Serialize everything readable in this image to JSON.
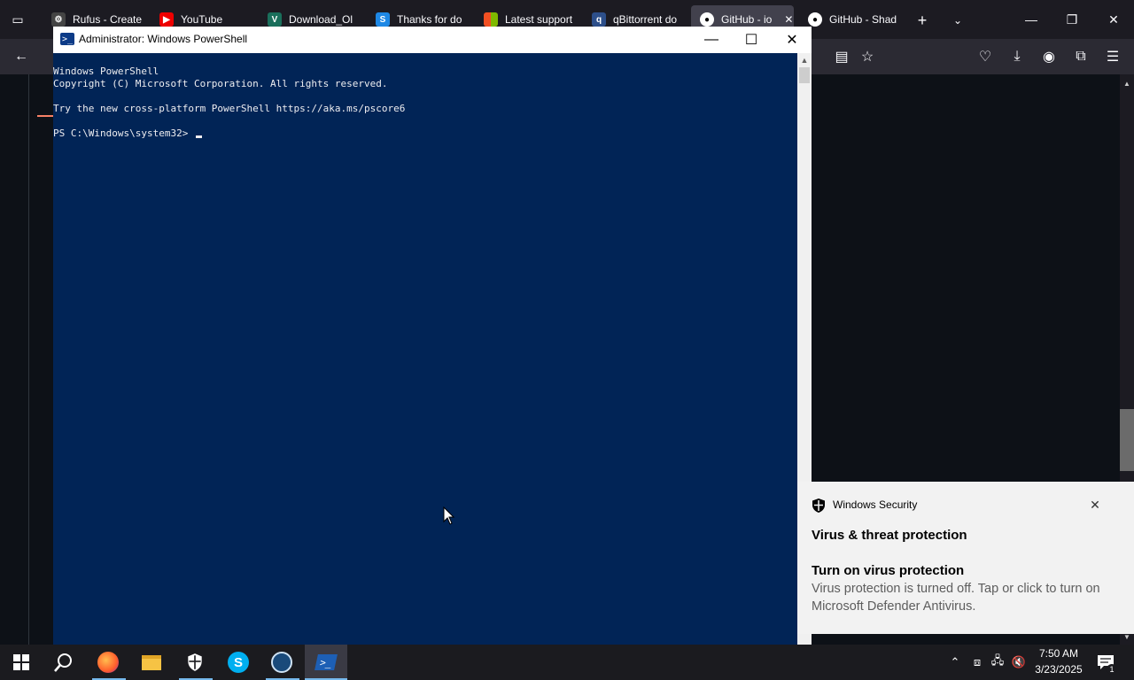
{
  "browser": {
    "tabs": [
      {
        "label": "Rufus - Create",
        "icon": "rufus-icon"
      },
      {
        "label": "YouTube",
        "icon": "youtube-icon"
      },
      {
        "label": "Download_Ol",
        "icon": "download-icon"
      },
      {
        "label": "Thanks for do",
        "icon": "skype-icon"
      },
      {
        "label": "Latest support",
        "icon": "microsoft-icon"
      },
      {
        "label": "qBittorrent do",
        "icon": "qbittorrent-icon"
      },
      {
        "label": "GitHub - io",
        "icon": "github-icon"
      },
      {
        "label": "GitHub - Shad",
        "icon": "github-icon"
      }
    ],
    "colors": {
      "bg": "#1c1b22",
      "page": "#0d1117"
    }
  },
  "powershell": {
    "title": "Administrator: Windows PowerShell",
    "lines": [
      "Windows PowerShell",
      "Copyright (C) Microsoft Corporation. All rights reserved.",
      "",
      "Try the new cross-platform PowerShell https://aka.ms/pscore6",
      "",
      "PS C:\\Windows\\system32> "
    ],
    "colors": {
      "background": "#012456",
      "text": "#eeedf0"
    }
  },
  "toast": {
    "app_name": "Windows Security",
    "heading": "Virus & threat protection",
    "subtitle": "Turn on virus protection",
    "body": "Virus protection is turned off. Tap or click to turn on Microsoft Defender Antivirus."
  },
  "taskbar": {
    "apps": [
      "firefox-icon",
      "file-explorer-icon",
      "windows-security-icon",
      "skype-icon",
      "steam-icon",
      "powershell-icon"
    ],
    "time": "7:50 AM",
    "date": "3/23/2025",
    "notification_count": "1"
  }
}
